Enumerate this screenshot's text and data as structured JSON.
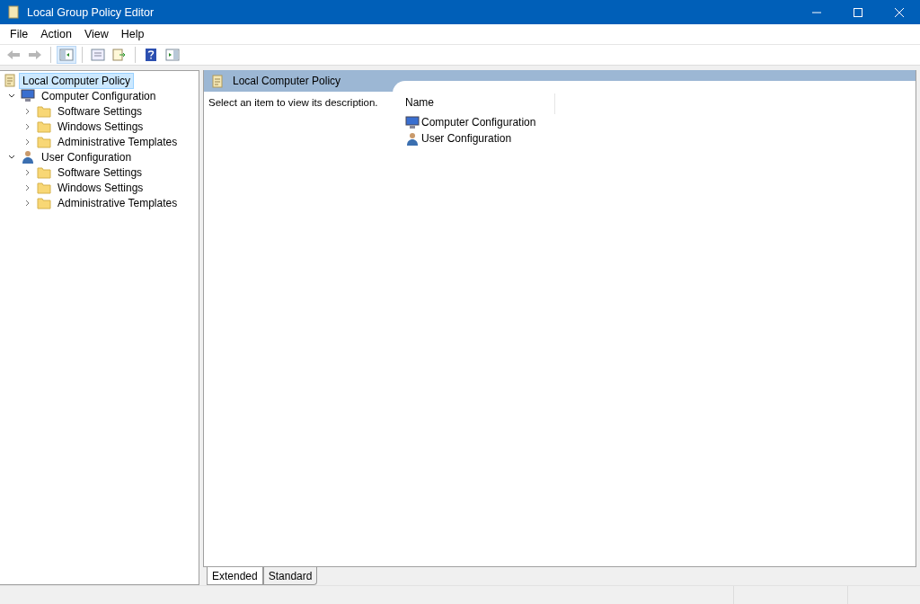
{
  "window": {
    "title": "Local Group Policy Editor"
  },
  "menu": [
    "File",
    "Action",
    "View",
    "Help"
  ],
  "toolbar": [
    {
      "kind": "back",
      "disabled": true
    },
    {
      "kind": "forward",
      "disabled": true
    },
    {
      "kind": "sep"
    },
    {
      "kind": "tree",
      "selected": true
    },
    {
      "kind": "sep"
    },
    {
      "kind": "properties",
      "selected": false
    },
    {
      "kind": "export",
      "selected": false
    },
    {
      "kind": "sep"
    },
    {
      "kind": "help",
      "selected": false
    },
    {
      "kind": "view",
      "selected": false
    }
  ],
  "tree": [
    {
      "label": "Local Computer Policy",
      "kind": "policy",
      "selected": true,
      "children": [
        {
          "label": "Computer Configuration",
          "kind": "computer",
          "selected": false,
          "expanded": true,
          "children": [
            {
              "label": "Software Settings",
              "kind": "folder",
              "selected": false,
              "expanded": false
            },
            {
              "label": "Windows Settings",
              "kind": "folder",
              "selected": false,
              "expanded": false
            },
            {
              "label": "Administrative Templates",
              "kind": "folder",
              "selected": false,
              "expanded": false
            }
          ]
        },
        {
          "label": "User Configuration",
          "kind": "user",
          "selected": false,
          "expanded": true,
          "children": [
            {
              "label": "Software Settings",
              "kind": "folder",
              "selected": false,
              "expanded": false
            },
            {
              "label": "Windows Settings",
              "kind": "folder",
              "selected": false,
              "expanded": false
            },
            {
              "label": "Administrative Templates",
              "kind": "folder",
              "selected": false,
              "expanded": false
            }
          ]
        }
      ]
    }
  ],
  "details": {
    "title": "Local Computer Policy",
    "description": "Select an item to view its description.",
    "columns": [
      "Name"
    ],
    "items": [
      {
        "label": "Computer Configuration",
        "kind": "computer"
      },
      {
        "label": "User Configuration",
        "kind": "user"
      }
    ]
  },
  "view_tabs": [
    {
      "label": "Extended",
      "selected": true
    },
    {
      "label": "Standard",
      "selected": false
    }
  ]
}
